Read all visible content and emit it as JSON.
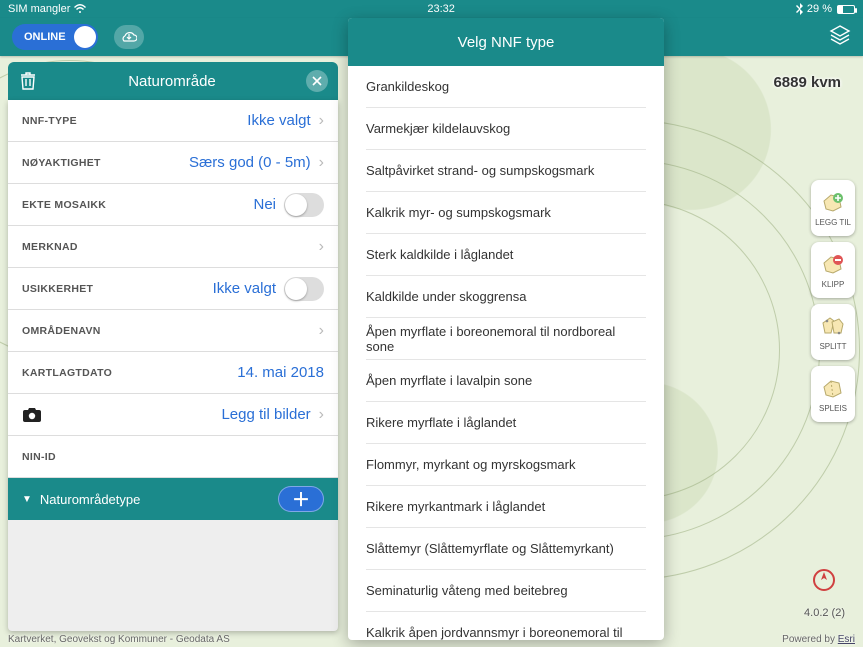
{
  "status": {
    "left": "SIM mangler",
    "time": "23:32",
    "battery": "29 %"
  },
  "topbar": {
    "online_label": "ONLINE"
  },
  "map": {
    "scale_label": "6889 kvm"
  },
  "panel": {
    "title": "Naturområde",
    "rows": {
      "nnf_type_label": "NNF-TYPE",
      "nnf_type_value": "Ikke valgt",
      "accuracy_label": "NØYAKTIGHET",
      "accuracy_value": "Særs god (0 - 5m)",
      "mosaic_label": "EKTE MOSAIKK",
      "mosaic_value": "Nei",
      "note_label": "MERKNAD",
      "uncertainty_label": "USIKKERHET",
      "uncertainty_value": "Ikke valgt",
      "areaname_label": "OMRÅDENAVN",
      "date_label": "KARTLAGTDATO",
      "date_value": "14. mai 2018",
      "photos_label": "Legg til bilder",
      "ninid_label": "NIN-ID"
    },
    "section": "Naturområdetype"
  },
  "tools": {
    "legg_til": "LEGG TIL",
    "klipp": "KLIPP",
    "splitt": "SPLITT",
    "spleis": "SPLEIS"
  },
  "popup": {
    "title": "Velg NNF type",
    "items": [
      "Grankildeskog",
      "Varmekjær kildelauvskog",
      "Saltpåvirket strand- og sumpskogsmark",
      "Kalkrik myr- og sumpskogsmark",
      "Sterk kaldkilde i låglandet",
      "Kaldkilde under skoggrensa",
      "Åpen myrflate i boreonemoral til nordboreal sone",
      "Åpen myrflate i lavalpin sone",
      "Rikere myrflate i låglandet",
      "Flommyr, myrkant og myrskogsmark",
      "Rikere myrkantmark i låglandet",
      "Slåttemyr (Slåttemyrflate og Slåttemyrkant)",
      "Seminaturlig våteng med beitebreg",
      "Kalkrik åpen jordvannsmyr i boreonemoral til"
    ]
  },
  "footer": {
    "version": "4.0.2 (2)",
    "attrib_left": "Kartverket, Geovekst og Kommuner - Geodata AS",
    "powered_by": "Powered by ",
    "esri": "Esri"
  }
}
